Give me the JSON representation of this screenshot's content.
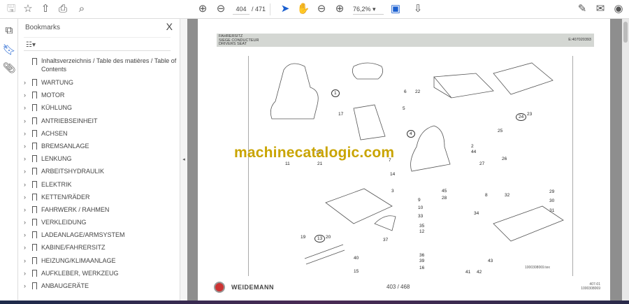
{
  "toolbar": {
    "page_current": "404",
    "page_total": "/ 471",
    "zoom": "76,2%",
    "icons": [
      "save-icon",
      "star-icon",
      "upload-icon",
      "print-icon",
      "search-icon",
      "page-up-icon",
      "page-down-icon",
      "select-cursor-icon",
      "hand-icon",
      "zoom-out-icon",
      "zoom-in-icon",
      "fit-page-icon",
      "scroll-mode-icon",
      "sign-icon",
      "mail-icon",
      "account-icon"
    ]
  },
  "sidebar": {
    "title": "Bookmarks",
    "close": "X",
    "items": [
      {
        "label": "Inhaltsverzeichnis / Table des matières / Table of Contents",
        "expandable": false
      },
      {
        "label": "WARTUNG",
        "expandable": true
      },
      {
        "label": "MOTOR",
        "expandable": true
      },
      {
        "label": "KÜHLUNG",
        "expandable": true
      },
      {
        "label": "ANTRIEBSEINHEIT",
        "expandable": true
      },
      {
        "label": "ACHSEN",
        "expandable": true
      },
      {
        "label": "BREMSANLAGE",
        "expandable": true
      },
      {
        "label": "LENKUNG",
        "expandable": true
      },
      {
        "label": "ARBEITSHYDRAULIK",
        "expandable": true
      },
      {
        "label": "ELEKTRIK",
        "expandable": true
      },
      {
        "label": "KETTEN/RÄDER",
        "expandable": true
      },
      {
        "label": "FAHRWERK / RAHMEN",
        "expandable": true
      },
      {
        "label": "VERKLEIDUNG",
        "expandable": true
      },
      {
        "label": "LADEANLAGE/ARMSYSTEM",
        "expandable": true
      },
      {
        "label": "KABINE/FAHRERSITZ",
        "expandable": true
      },
      {
        "label": "HEIZUNG/KLIMAANLAGE",
        "expandable": true
      },
      {
        "label": "AUFKLEBER, WERKZEUG",
        "expandable": true
      },
      {
        "label": "ANBAUGERÄTE",
        "expandable": true
      }
    ]
  },
  "document": {
    "header": {
      "line1": "FAHRERSITZ",
      "line2": "SIEGE CONDUCTEUR",
      "line3": "DRIVERS SEAT",
      "code": "E:407020393"
    },
    "watermark": "machinecatalogic.com",
    "callouts": [
      "1",
      "17",
      "6",
      "5",
      "22",
      "4",
      "23",
      "24",
      "25",
      "2",
      "44",
      "26",
      "27",
      "18",
      "21",
      "11",
      "7",
      "14",
      "3",
      "45",
      "28",
      "29",
      "30",
      "31",
      "32",
      "8",
      "9",
      "10",
      "33",
      "34",
      "35",
      "12",
      "13",
      "20",
      "37",
      "36",
      "39",
      "16",
      "15",
      "19",
      "40",
      "41",
      "42",
      "43"
    ],
    "drawing_code": "1000308069.tex",
    "footer": {
      "brand": "WEIDEMANN",
      "page": "403 / 468",
      "code1": "407-01",
      "code2": "1000308069"
    }
  }
}
